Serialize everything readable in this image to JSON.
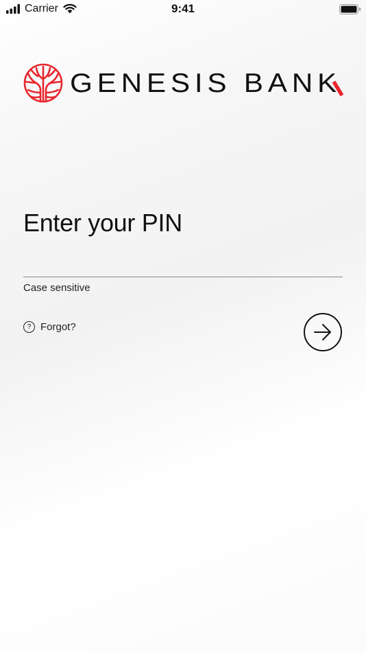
{
  "status_bar": {
    "carrier": "Carrier",
    "time": "9:41",
    "signal_icon": "signal-bars-icon",
    "wifi_icon": "wifi-icon",
    "battery_icon": "battery-icon"
  },
  "brand": {
    "name": "GENESIS BANK",
    "logo_icon": "tree-logo-icon",
    "colors": {
      "accent": "#e8262d",
      "text": "#111111"
    }
  },
  "pin_form": {
    "title": "Enter your PIN",
    "input_value": "",
    "hint": "Case sensitive",
    "forgot_label": "Forgot?",
    "help_icon_glyph": "?",
    "submit_icon": "arrow-right-icon"
  }
}
